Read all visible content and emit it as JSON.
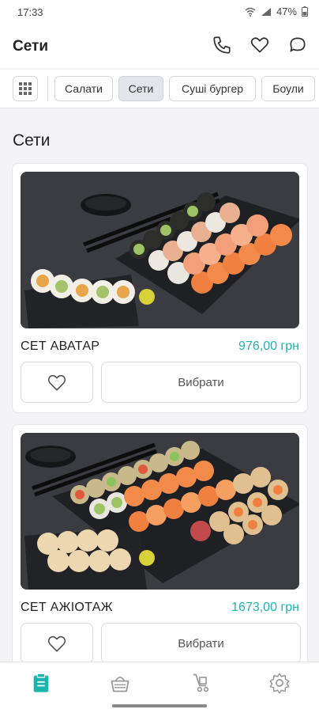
{
  "status_bar": {
    "time": "17:33",
    "battery": "47%"
  },
  "header": {
    "title": "Сети"
  },
  "categories": [
    {
      "label": "Салати",
      "active": false
    },
    {
      "label": "Сети",
      "active": true
    },
    {
      "label": "Суші бургер",
      "active": false
    },
    {
      "label": "Боули",
      "active": false
    }
  ],
  "section": {
    "title": "Сети"
  },
  "products": [
    {
      "name": "СЕТ АВАТАР",
      "price": "976,00 грн",
      "button": "Вибрати"
    },
    {
      "name": "СЕТ АЖІОТАЖ",
      "price": "1673,00 грн",
      "button": "Вибрати"
    }
  ],
  "colors": {
    "accent": "#1bb5b0"
  },
  "nav": [
    "menu-icon",
    "basket-icon",
    "cart-icon",
    "settings-icon"
  ]
}
